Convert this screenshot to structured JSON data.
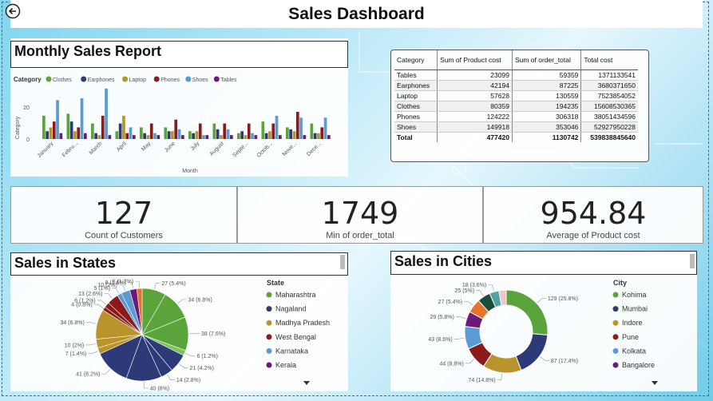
{
  "dashboard": {
    "title": "Sales Dashboard"
  },
  "monthly": {
    "title": "Monthly Sales Report",
    "legend_title": "Category",
    "ylabel": "Category",
    "xlabel": "Month",
    "yticks": [
      "20",
      "0"
    ]
  },
  "chart_data": [
    {
      "type": "bar",
      "title": "Monthly Sales Report",
      "xlabel": "Month",
      "ylabel": "Category",
      "ylim": [
        0,
        28
      ],
      "categories": [
        "January",
        "Febru...",
        "March",
        "April",
        "May",
        "June",
        "July",
        "August",
        "Septe...",
        "Octob...",
        "Nove...",
        "Dece..."
      ],
      "series": [
        {
          "name": "Clothes",
          "color": "#5ba33b",
          "values": [
            12,
            13,
            8,
            4,
            6,
            6,
            4,
            8,
            3,
            9,
            6,
            8
          ]
        },
        {
          "name": "Earphones",
          "color": "#2d3a78",
          "values": [
            4,
            9,
            3,
            8,
            3,
            4,
            3,
            5,
            4,
            3,
            5,
            3
          ]
        },
        {
          "name": "Laptop",
          "color": "#b8942a",
          "values": [
            6,
            4,
            2,
            12,
            2,
            4,
            4,
            2,
            2,
            4,
            4,
            3
          ]
        },
        {
          "name": "Phones",
          "color": "#8b1a1a",
          "values": [
            9,
            6,
            12,
            3,
            8,
            10,
            8,
            8,
            8,
            8,
            14,
            6
          ]
        },
        {
          "name": "Shoes",
          "color": "#5b9bd5",
          "values": [
            20,
            21,
            26,
            6,
            3,
            5,
            2,
            5,
            3,
            12,
            11,
            11
          ]
        },
        {
          "name": "Tables",
          "color": "#6a1b7a",
          "values": [
            3,
            3,
            2,
            2,
            2,
            2,
            2,
            2,
            2,
            2,
            2,
            2
          ]
        }
      ]
    },
    {
      "type": "pie",
      "title": "Sales in States",
      "legend_title": "State",
      "legend": [
        {
          "name": "Maharashtra",
          "color": "#5ba33b"
        },
        {
          "name": "Nagaland",
          "color": "#2d3a78"
        },
        {
          "name": "Madhya Pradesh",
          "color": "#b8942a"
        },
        {
          "name": "West Bengal",
          "color": "#8b1a1a"
        },
        {
          "name": "Karnataka",
          "color": "#5b9bd5"
        },
        {
          "name": "Kerala",
          "color": "#6a1b7a"
        }
      ],
      "slices": [
        {
          "label": "27 (5.4%)",
          "value": 27,
          "color": "#5ba33b"
        },
        {
          "label": "34 (6.8%)",
          "value": 34,
          "color": "#5ba33b"
        },
        {
          "label": "38 (7.6%)",
          "value": 38,
          "color": "#5ba33b"
        },
        {
          "label": "6 (1.2%)",
          "value": 6,
          "color": "#7fc25c"
        },
        {
          "label": "21 (4.2%)",
          "value": 21,
          "color": "#2d3a78"
        },
        {
          "label": "14 (2.8%)",
          "value": 14,
          "color": "#2d3a78"
        },
        {
          "label": "40 (8%)",
          "value": 40,
          "color": "#2d3a78"
        },
        {
          "label": "41 (8.2%)",
          "value": 41,
          "color": "#2d3a78"
        },
        {
          "label": "7 (1.4%)",
          "value": 7,
          "color": "#b8942a"
        },
        {
          "label": "10 (2%)",
          "value": 10,
          "color": "#b8942a"
        },
        {
          "label": "34 (6.8%)",
          "value": 34,
          "color": "#b8942a"
        },
        {
          "label": "4 (0.8%)",
          "value": 4,
          "color": "#8b1a1a"
        },
        {
          "label": "6 (1.2%)",
          "value": 6,
          "color": "#8b1a1a"
        },
        {
          "label": "13 (2.6%)",
          "value": 13,
          "color": "#8b1a1a"
        },
        {
          "label": "5 (1%)",
          "value": 5,
          "color": "#5b9bd5"
        },
        {
          "label": "10 (2%)",
          "value": 10,
          "color": "#5b9bd5"
        },
        {
          "label": "8 (1.6%)",
          "value": 8,
          "color": "#6a1b7a"
        },
        {
          "label": "6 (1.2%)",
          "value": 6,
          "color": "#e8732a"
        }
      ]
    },
    {
      "type": "pie",
      "title": "Sales in Cities",
      "legend_title": "City",
      "legend": [
        {
          "name": "Kohima",
          "color": "#5ba33b"
        },
        {
          "name": "Mumbai",
          "color": "#2d3a78"
        },
        {
          "name": "Indore",
          "color": "#b8942a"
        },
        {
          "name": "Pune",
          "color": "#8b1a1a"
        },
        {
          "name": "Kolkata",
          "color": "#5b9bd5"
        },
        {
          "name": "Bangalore",
          "color": "#6a1b7a"
        }
      ],
      "slices": [
        {
          "label": "129 (25.8%)",
          "value": 129,
          "color": "#5ba33b"
        },
        {
          "label": "87 (17.4%)",
          "value": 87,
          "color": "#2d3a78"
        },
        {
          "label": "74 (14.8%)",
          "value": 74,
          "color": "#b8942a"
        },
        {
          "label": "44 (8.8%)",
          "value": 44,
          "color": "#8b1a1a"
        },
        {
          "label": "43 (8.6%)",
          "value": 43,
          "color": "#5b9bd5"
        },
        {
          "label": "29 (5.8%)",
          "value": 29,
          "color": "#6a1b7a"
        },
        {
          "label": "27 (5.4%)",
          "value": 27,
          "color": "#e8732a"
        },
        {
          "label": "25 (5%)",
          "value": 25,
          "color": "#1a4d3a"
        },
        {
          "label": "18 (3.6%)",
          "value": 18,
          "color": "#4fa3a5"
        },
        {
          "label": "",
          "value": 14,
          "color": "#f2c4c8"
        }
      ]
    }
  ],
  "summary_table": {
    "headers": [
      "Category",
      "Sum of Product cost",
      "Sum of order_total",
      "Total cost"
    ],
    "rows": [
      [
        "Tables",
        "23099",
        "59359",
        "1371133541"
      ],
      [
        "Earphones",
        "42194",
        "87225",
        "3680371650"
      ],
      [
        "Laptop",
        "57628",
        "130559",
        "7523854052"
      ],
      [
        "Clothes",
        "80359",
        "194235",
        "15608530365"
      ],
      [
        "Phones",
        "124222",
        "306318",
        "38051434596"
      ],
      [
        "Shoes",
        "149918",
        "353046",
        "52927950228"
      ]
    ],
    "total": [
      "Total",
      "477420",
      "1130742",
      "539838845640"
    ]
  },
  "kpis": [
    {
      "value": "127",
      "label": "Count of Customers"
    },
    {
      "value": "1749",
      "label": "Min of order_total"
    },
    {
      "value": "954.84",
      "label": "Average of Product cost"
    }
  ],
  "states": {
    "title": "Sales in States",
    "legend_title": "State"
  },
  "cities": {
    "title": "Sales in Cities",
    "legend_title": "City"
  }
}
